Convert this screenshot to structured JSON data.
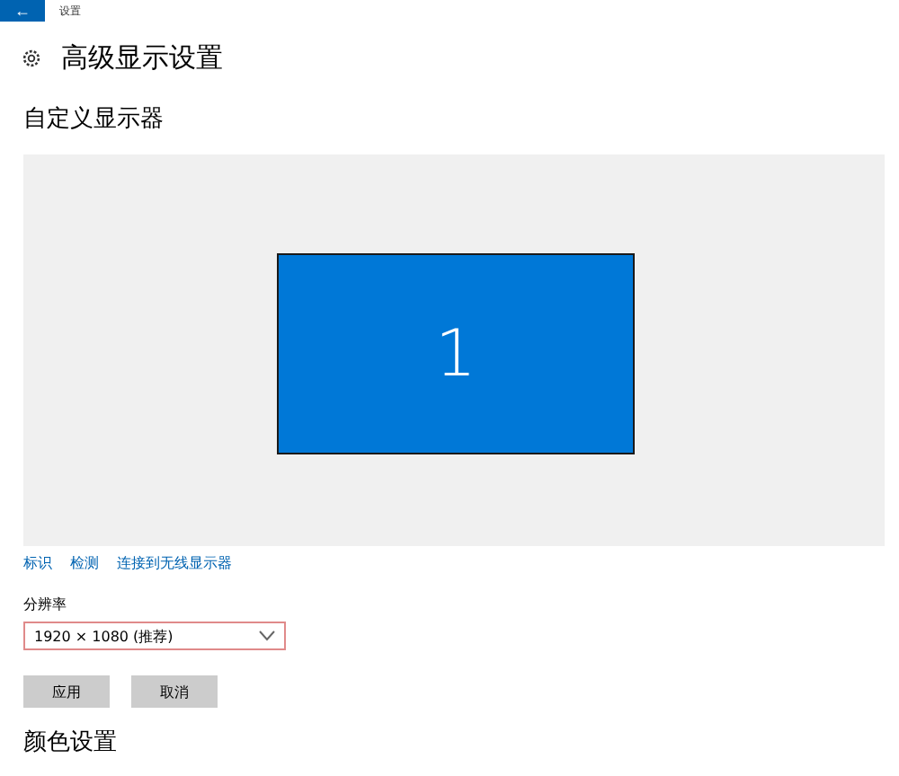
{
  "window": {
    "title": "设置",
    "back_icon": "←"
  },
  "heading": "高级显示设置",
  "section_title": "自定义显示器",
  "displays": [
    {
      "label": "1"
    }
  ],
  "links": [
    "标识",
    "检测",
    "连接到无线显示器"
  ],
  "resolution": {
    "label": "分辨率",
    "value": "1920 × 1080 (推荐)",
    "highlighted": true
  },
  "buttons": [
    "应用",
    "取消"
  ],
  "next_section": "颜色设置"
}
